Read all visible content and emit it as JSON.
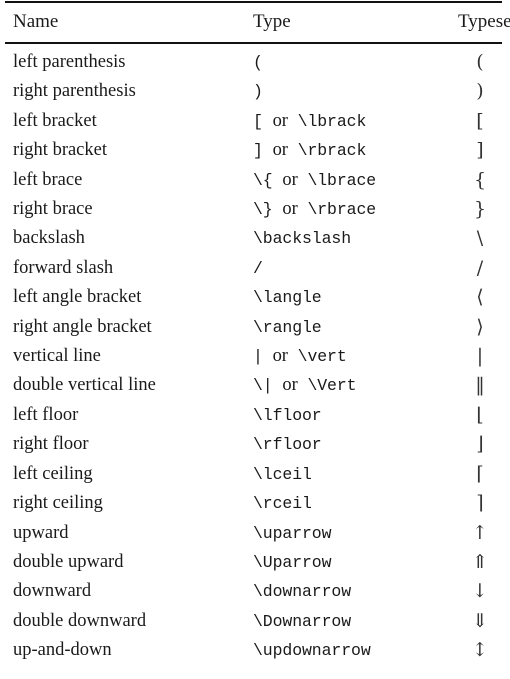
{
  "table": {
    "columns": [
      "Name",
      "Type",
      "Typeset"
    ],
    "rows": [
      {
        "name": "left parenthesis",
        "type_pre": "(",
        "type_or": "",
        "type_post": "",
        "typeset": "("
      },
      {
        "name": "right parenthesis",
        "type_pre": ")",
        "type_or": "",
        "type_post": "",
        "typeset": ")"
      },
      {
        "name": "left bracket",
        "type_pre": "[",
        "type_or": "or",
        "type_post": "\\lbrack",
        "typeset": "["
      },
      {
        "name": "right bracket",
        "type_pre": "]",
        "type_or": "or",
        "type_post": "\\rbrack",
        "typeset": "]"
      },
      {
        "name": "left brace",
        "type_pre": "\\{",
        "type_or": "or",
        "type_post": "\\lbrace",
        "typeset": "{"
      },
      {
        "name": "right brace",
        "type_pre": "\\}",
        "type_or": "or",
        "type_post": "\\rbrace",
        "typeset": "}"
      },
      {
        "name": "backslash",
        "type_pre": "\\backslash",
        "type_or": "",
        "type_post": "",
        "typeset": "\\"
      },
      {
        "name": "forward slash",
        "type_pre": "/",
        "type_or": "",
        "type_post": "",
        "typeset": "/"
      },
      {
        "name": "left angle bracket",
        "type_pre": "\\langle",
        "type_or": "",
        "type_post": "",
        "typeset": "⟨"
      },
      {
        "name": "right angle bracket",
        "type_pre": "\\rangle",
        "type_or": "",
        "type_post": "",
        "typeset": "⟩"
      },
      {
        "name": "vertical line",
        "type_pre": "|",
        "type_or": "or",
        "type_post": "\\vert",
        "typeset": "|"
      },
      {
        "name": "double vertical line",
        "type_pre": "\\|",
        "type_or": "or",
        "type_post": "\\Vert",
        "typeset": "‖"
      },
      {
        "name": "left floor",
        "type_pre": "\\lfloor",
        "type_or": "",
        "type_post": "",
        "typeset": "⌊"
      },
      {
        "name": "right floor",
        "type_pre": "\\rfloor",
        "type_or": "",
        "type_post": "",
        "typeset": "⌋"
      },
      {
        "name": "left ceiling",
        "type_pre": "\\lceil",
        "type_or": "",
        "type_post": "",
        "typeset": "⌈"
      },
      {
        "name": "right ceiling",
        "type_pre": "\\rceil",
        "type_or": "",
        "type_post": "",
        "typeset": "⌉"
      },
      {
        "name": "upward",
        "type_pre": "\\uparrow",
        "type_or": "",
        "type_post": "",
        "typeset": "↑"
      },
      {
        "name": "double upward",
        "type_pre": "\\Uparrow",
        "type_or": "",
        "type_post": "",
        "typeset": "⇑"
      },
      {
        "name": "downward",
        "type_pre": "\\downarrow",
        "type_or": "",
        "type_post": "",
        "typeset": "↓"
      },
      {
        "name": "double downward",
        "type_pre": "\\Downarrow",
        "type_or": "",
        "type_post": "",
        "typeset": "⇓"
      },
      {
        "name": "up-and-down",
        "type_pre": "\\updownarrow",
        "type_or": "",
        "type_post": "",
        "typeset": "↕"
      }
    ]
  },
  "style": {
    "rule_color": "#111111",
    "text_color": "#1a1a1a",
    "background": "#ffffff"
  }
}
